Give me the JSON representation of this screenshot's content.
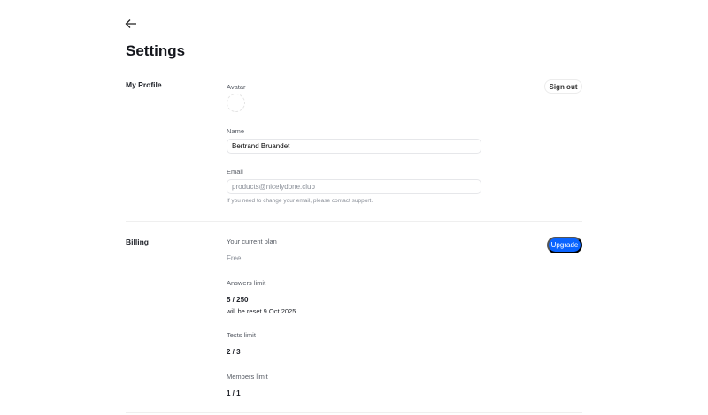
{
  "header": {
    "title": "Settings"
  },
  "profile": {
    "section_title": "My Profile",
    "avatar_label": "Avatar",
    "name_label": "Name",
    "name_value": "Bertrand Bruandet",
    "email_label": "Email",
    "email_value": "products@nicelydone.club",
    "email_help": "If you need to change your email, please contact support.",
    "sign_out_label": "Sign out"
  },
  "billing": {
    "section_title": "Billing",
    "plan_label": "Your current plan",
    "plan_value": "Free",
    "upgrade_label": "Upgrade",
    "answers_label": "Answers limit",
    "answers_value": "5 / 250",
    "answers_reset": "will be reset 9 Oct 2025",
    "tests_label": "Tests limit",
    "tests_value": "2 / 3",
    "members_label": "Members limit",
    "members_value": "1 / 1"
  }
}
